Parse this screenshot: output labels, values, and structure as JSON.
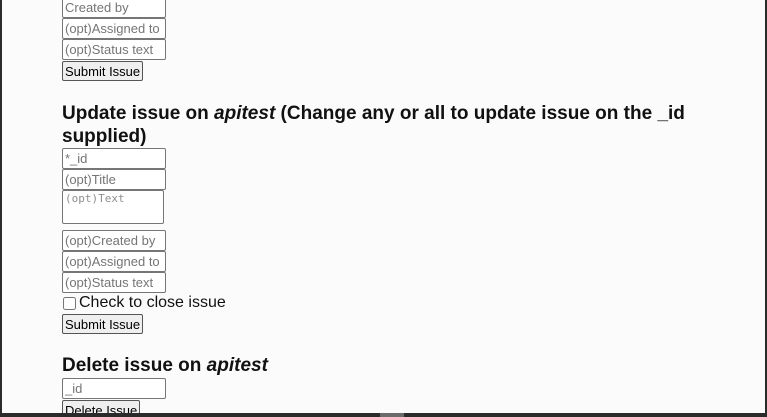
{
  "create_form": {
    "created_by_placeholder": "Created by",
    "assigned_to_placeholder": "(opt)Assigned to",
    "status_text_placeholder": "(opt)Status text",
    "submit_label": "Submit Issue"
  },
  "update_form": {
    "heading_prefix": "Update issue on ",
    "project": "apitest",
    "heading_suffix": " (Change any or all to update issue on the _id supplied)",
    "id_placeholder": "*_id",
    "title_placeholder": "(opt)Title",
    "text_placeholder": "(opt)Text",
    "created_by_placeholder": "(opt)Created by",
    "assigned_to_placeholder": "(opt)Assigned to",
    "status_text_placeholder": "(opt)Status text",
    "close_checkbox_label": "Check to close issue",
    "submit_label": "Submit Issue"
  },
  "delete_form": {
    "heading_prefix": "Delete issue on ",
    "project": "apitest",
    "id_placeholder": "_id",
    "submit_label": "Delete Issue"
  }
}
